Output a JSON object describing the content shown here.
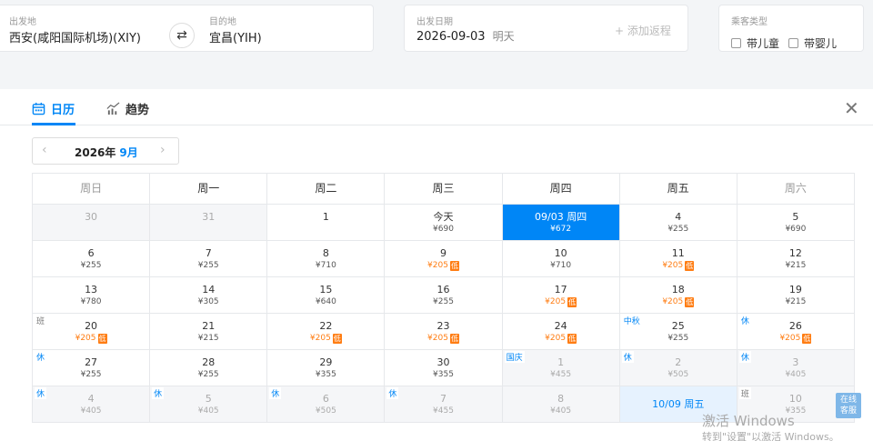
{
  "search": {
    "from_label": "出发地",
    "from_value": "西安(咸阳国际机场)(XIY)",
    "to_label": "目的地",
    "to_value": "宜昌(YIH)",
    "date_label": "出发日期",
    "date_value": "2026-09-03",
    "date_note": "明天",
    "add_return": "+ 添加返程",
    "passenger_label": "乘客类型",
    "child_label": "带儿童",
    "infant_label": "带婴儿"
  },
  "tabs": {
    "calendar": "日历",
    "trend": "趋势"
  },
  "month": {
    "year": "2026年",
    "month": "9月"
  },
  "weekdays": [
    "周日",
    "周一",
    "周二",
    "周三",
    "周四",
    "周五",
    "周六"
  ],
  "weeks": [
    [
      {
        "day": "30",
        "price": "",
        "muted": true
      },
      {
        "day": "31",
        "price": "",
        "muted": true
      },
      {
        "day": "1",
        "price": ""
      },
      {
        "day": "今天",
        "price": "¥690"
      },
      {
        "day": "09/03 周四",
        "price": "¥672",
        "selected": true
      },
      {
        "day": "4",
        "price": "¥255"
      },
      {
        "day": "5",
        "price": "¥690"
      }
    ],
    [
      {
        "day": "6",
        "price": "¥255"
      },
      {
        "day": "7",
        "price": "¥255"
      },
      {
        "day": "8",
        "price": "¥710"
      },
      {
        "day": "9",
        "price": "¥205",
        "low": true
      },
      {
        "day": "10",
        "price": "¥710"
      },
      {
        "day": "11",
        "price": "¥205",
        "low": true
      },
      {
        "day": "12",
        "price": "¥215"
      }
    ],
    [
      {
        "day": "13",
        "price": "¥780"
      },
      {
        "day": "14",
        "price": "¥305"
      },
      {
        "day": "15",
        "price": "¥640"
      },
      {
        "day": "16",
        "price": "¥255"
      },
      {
        "day": "17",
        "price": "¥205",
        "low": true
      },
      {
        "day": "18",
        "price": "¥205",
        "low": true
      },
      {
        "day": "19",
        "price": "¥215"
      }
    ],
    [
      {
        "day": "20",
        "price": "¥205",
        "low": true,
        "tag": "班"
      },
      {
        "day": "21",
        "price": "¥215"
      },
      {
        "day": "22",
        "price": "¥205",
        "low": true
      },
      {
        "day": "23",
        "price": "¥205",
        "low": true
      },
      {
        "day": "24",
        "price": "¥205",
        "low": true
      },
      {
        "day": "25",
        "price": "¥255",
        "tag": "中秋"
      },
      {
        "day": "26",
        "price": "¥205",
        "low": true,
        "tag": "休"
      }
    ],
    [
      {
        "day": "27",
        "price": "¥255",
        "tag": "休"
      },
      {
        "day": "28",
        "price": "¥255"
      },
      {
        "day": "29",
        "price": "¥355"
      },
      {
        "day": "30",
        "price": "¥355"
      },
      {
        "day": "1",
        "price": "¥455",
        "muted": true,
        "tag": "国庆"
      },
      {
        "day": "2",
        "price": "¥505",
        "muted": true,
        "tag": "休"
      },
      {
        "day": "3",
        "price": "¥405",
        "muted": true,
        "tag": "休"
      }
    ],
    [
      {
        "day": "4",
        "price": "¥405",
        "muted": true,
        "tag": "休"
      },
      {
        "day": "5",
        "price": "¥405",
        "muted": true,
        "tag": "休"
      },
      {
        "day": "6",
        "price": "¥505",
        "muted": true,
        "tag": "休"
      },
      {
        "day": "7",
        "price": "¥455",
        "muted": true,
        "tag": "休"
      },
      {
        "day": "8",
        "price": "¥405",
        "muted": true
      },
      {
        "day": "10/09 周五",
        "price": "",
        "ret": true
      },
      {
        "day": "10",
        "price": "¥355",
        "muted": true,
        "tag": "班"
      }
    ]
  ],
  "low_badge": "低",
  "watermark": {
    "line1": "激活 Windows",
    "line2": "转到\"设置\"以激活 Windows。"
  },
  "service": {
    "line1": "在线",
    "line2": "客服"
  },
  "colors": {
    "accent": "#0086f6",
    "low_price": "#ff7d13"
  },
  "icons": {
    "swap": "swap-arrows-icon",
    "calendar": "calendar-icon",
    "trend": "trend-chart-icon",
    "close": "close-icon"
  }
}
